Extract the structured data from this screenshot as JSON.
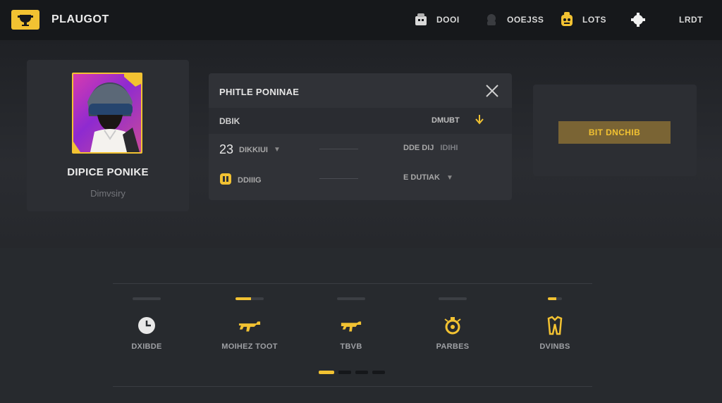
{
  "brand": {
    "title": "PLAUGOT",
    "logo_icon": "trophy-icon",
    "accent": "#f2c232"
  },
  "nav": {
    "items": [
      {
        "label": "DOOI",
        "icon": "shop-icon"
      },
      {
        "label": "OOEJSS",
        "icon": "character-icon"
      },
      {
        "label": "LOTS",
        "icon": "lootbox-icon"
      },
      {
        "label": "",
        "icon": "settings-icon"
      },
      {
        "label": "LRDT",
        "icon": ""
      }
    ]
  },
  "profile": {
    "name": "DIPICE PONIKE",
    "subtitle": "Dimvsiry",
    "avatar_icon": "player-helmet-avatar"
  },
  "panel": {
    "title": "PHITLE PONINAE",
    "header": {
      "left": "DBIK",
      "right": "DMUBT"
    },
    "rows": [
      {
        "value": "23",
        "label": "DIKKIUI",
        "right": "DDE DIJ",
        "right_extra": "IDIHI"
      },
      {
        "value": "",
        "label": "DDIIIG",
        "right": "E DUTIAK",
        "right_extra": ""
      }
    ]
  },
  "action": {
    "button_label": "BIT DNCHIB"
  },
  "categories": [
    {
      "label": "DXIBDE",
      "icon": "clock-icon",
      "active": false
    },
    {
      "label": "MOIHEZ TOOT",
      "icon": "rifle-icon",
      "active": true
    },
    {
      "label": "TBVB",
      "icon": "smg-icon",
      "active": false
    },
    {
      "label": "PARBES",
      "icon": "grenade-icon",
      "active": false
    },
    {
      "label": "DVINBS",
      "icon": "outfit-icon",
      "active": false
    }
  ],
  "pagination": {
    "pages": 4,
    "current": 1
  }
}
